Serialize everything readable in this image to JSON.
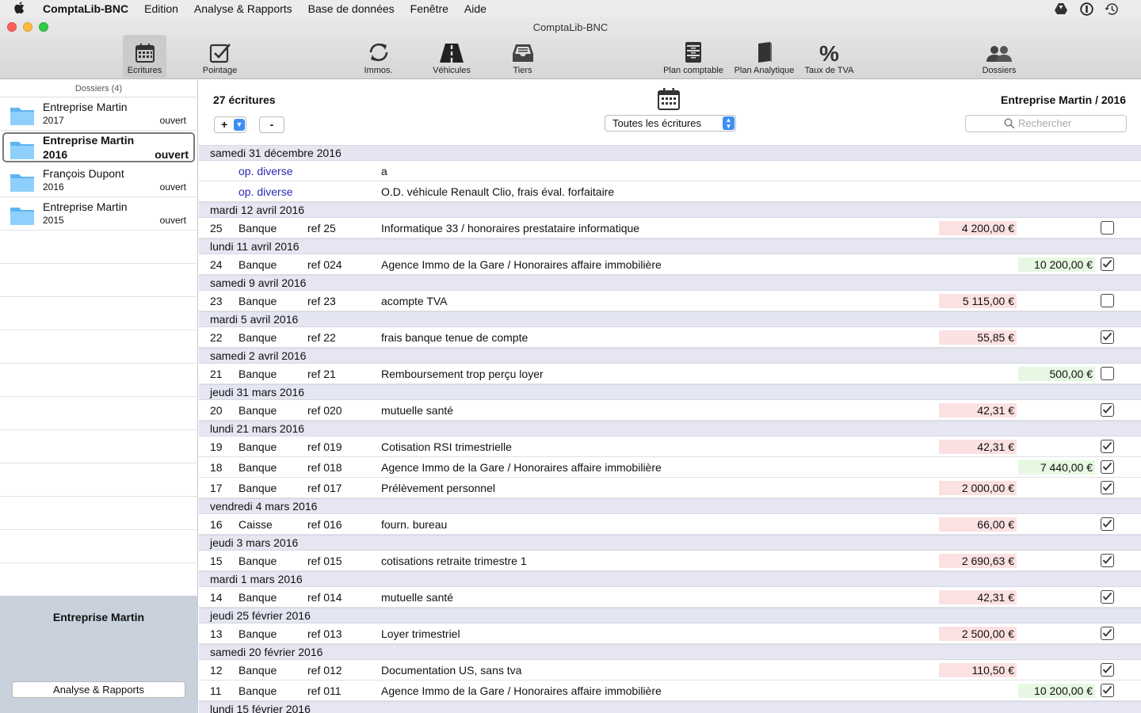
{
  "menubar": {
    "app": "ComptaLib-BNC",
    "items": [
      "Edition",
      "Analyse & Rapports",
      "Base de données",
      "Fenêtre",
      "Aide"
    ]
  },
  "window": {
    "title": "ComptaLib-BNC"
  },
  "toolbar": {
    "items": [
      {
        "label": "Ecritures",
        "icon": "calendar-icon",
        "active": true
      },
      {
        "label": "Pointage",
        "icon": "checkmark-icon"
      },
      {
        "label": "Immos.",
        "icon": "refresh-icon"
      },
      {
        "label": "Véhicules",
        "icon": "road-icon"
      },
      {
        "label": "Tiers",
        "icon": "inbox-icon"
      },
      {
        "label": "Plan comptable",
        "icon": "cabinet-icon"
      },
      {
        "label": "Plan Analytique",
        "icon": "book-icon"
      },
      {
        "label": "Taux de TVA",
        "icon": "percent-icon",
        "glyph": "%"
      },
      {
        "label": "Dossiers",
        "icon": "people-icon"
      }
    ]
  },
  "sidebar": {
    "header": "Dossiers (4)",
    "items": [
      {
        "name": "Entreprise Martin",
        "year": "2017",
        "status": "ouvert"
      },
      {
        "name": "Entreprise Martin",
        "year": "2016",
        "status": "ouvert",
        "selected": true
      },
      {
        "name": "François Dupont",
        "year": "2016",
        "status": "ouvert"
      },
      {
        "name": "Entreprise Martin",
        "year": "2015",
        "status": "ouvert"
      }
    ],
    "footer_entity": "Entreprise Martin",
    "footer_button": "Analyse & Rapports"
  },
  "main": {
    "count": "27 écritures",
    "add_label": "+",
    "remove_label": "-",
    "filter_value": "Toutes les écritures",
    "dossier_title": "Entreprise Martin / 2016",
    "search_placeholder": "Rechercher",
    "groups": [
      {
        "date": "samedi 31 décembre 2016",
        "rows": [
          {
            "op": "op. diverse",
            "label": "a"
          },
          {
            "op": "op. diverse",
            "label": "O.D. véhicule Renault Clio, frais éval. forfaitaire"
          }
        ]
      },
      {
        "date": "mardi 12 avril 2016",
        "rows": [
          {
            "num": "25",
            "journal": "Banque",
            "ref": "ref 25",
            "label": "Informatique 33 / honoraires prestataire informatique",
            "debit": "4 200,00 €",
            "checked": false
          }
        ]
      },
      {
        "date": "lundi 11 avril 2016",
        "rows": [
          {
            "num": "24",
            "journal": "Banque",
            "ref": "ref 024",
            "label": "Agence Immo de la Gare / Honoraires affaire immobilière",
            "credit": "10 200,00 €",
            "checked": true
          }
        ]
      },
      {
        "date": "samedi 9 avril 2016",
        "rows": [
          {
            "num": "23",
            "journal": "Banque",
            "ref": "ref 23",
            "label": "acompte TVA",
            "debit": "5 115,00 €",
            "checked": false
          }
        ]
      },
      {
        "date": "mardi 5 avril 2016",
        "rows": [
          {
            "num": "22",
            "journal": "Banque",
            "ref": "ref 22",
            "label": "frais banque tenue de compte",
            "debit": "55,85 €",
            "checked": true
          }
        ]
      },
      {
        "date": "samedi 2 avril 2016",
        "rows": [
          {
            "num": "21",
            "journal": "Banque",
            "ref": "ref 21",
            "label": "Remboursement trop perçu loyer",
            "credit": "500,00 €",
            "checked": false
          }
        ]
      },
      {
        "date": "jeudi 31 mars 2016",
        "rows": [
          {
            "num": "20",
            "journal": "Banque",
            "ref": "ref 020",
            "label": "mutuelle santé",
            "debit": "42,31 €",
            "checked": true
          }
        ]
      },
      {
        "date": "lundi 21 mars 2016",
        "rows": [
          {
            "num": "19",
            "journal": "Banque",
            "ref": "ref 019",
            "label": "Cotisation RSI trimestrielle",
            "debit": "42,31 €",
            "checked": true
          },
          {
            "num": "18",
            "journal": "Banque",
            "ref": "ref 018",
            "label": "Agence Immo de la Gare / Honoraires affaire immobilière",
            "credit": "7 440,00 €",
            "checked": true
          },
          {
            "num": "17",
            "journal": "Banque",
            "ref": "ref 017",
            "label": "Prélèvement personnel",
            "debit": "2 000,00 €",
            "checked": true
          }
        ]
      },
      {
        "date": "vendredi 4 mars 2016",
        "rows": [
          {
            "num": "16",
            "journal": "Caisse",
            "ref": "ref 016",
            "label": "fourn. bureau",
            "debit": "66,00 €",
            "checked": true
          }
        ]
      },
      {
        "date": "jeudi 3 mars 2016",
        "rows": [
          {
            "num": "15",
            "journal": "Banque",
            "ref": "ref 015",
            "label": "cotisations retraite trimestre 1",
            "debit": "2 690,63 €",
            "checked": true
          }
        ]
      },
      {
        "date": "mardi 1 mars 2016",
        "rows": [
          {
            "num": "14",
            "journal": "Banque",
            "ref": "ref 014",
            "label": "mutuelle santé",
            "debit": "42,31 €",
            "checked": true
          }
        ]
      },
      {
        "date": "jeudi 25 février 2016",
        "rows": [
          {
            "num": "13",
            "journal": "Banque",
            "ref": "ref 013",
            "label": "Loyer trimestriel",
            "debit": "2 500,00 €",
            "checked": true
          }
        ]
      },
      {
        "date": "samedi 20 février 2016",
        "rows": [
          {
            "num": "12",
            "journal": "Banque",
            "ref": "ref 012",
            "label": "Documentation US, sans tva",
            "debit": "110,50 €",
            "checked": true
          },
          {
            "num": "11",
            "journal": "Banque",
            "ref": "ref 011",
            "label": "Agence Immo de la Gare / Honoraires affaire immobilière",
            "credit": "10 200,00 €",
            "checked": true
          }
        ]
      },
      {
        "date": "lundi 15 février 2016",
        "rows": []
      }
    ]
  },
  "colors": {
    "date_row_bg": "#e5e6f2",
    "debit_bg": "#fbe1e1",
    "credit_bg": "#e6f8e2",
    "op_text": "#2a2ab0",
    "sidebar_footer_bg": "#c8d1dc",
    "accent": "#3d8ff5"
  }
}
